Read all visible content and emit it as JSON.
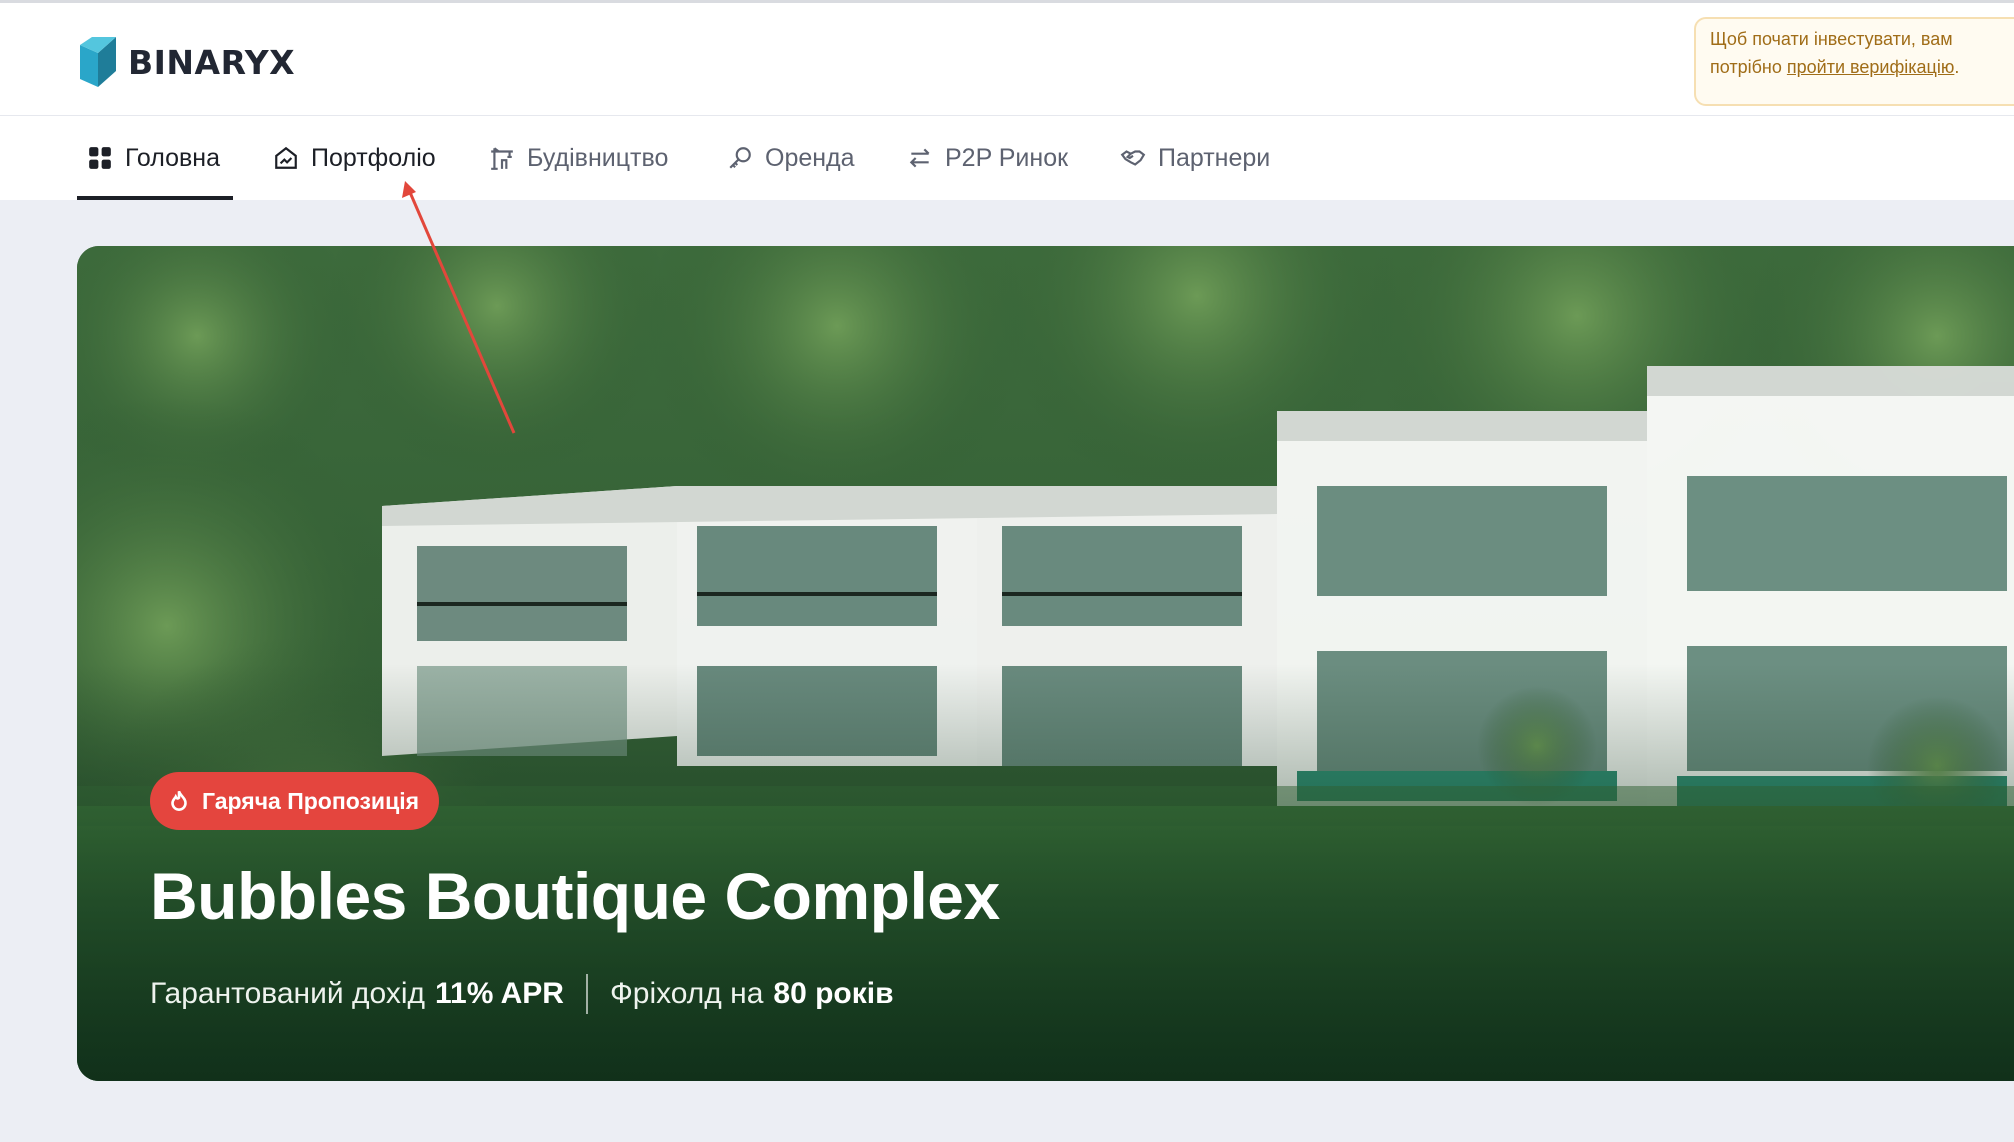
{
  "brand": {
    "name": "BINARYX",
    "logo_icon": "binaryx-logo-icon"
  },
  "notice": {
    "text_before": "Щоб почати інвестувати, вам потрібно ",
    "link_text": "пройти верифікацію",
    "text_after": "."
  },
  "nav": {
    "items": [
      {
        "label": "Головна",
        "icon": "grid-icon",
        "active": true
      },
      {
        "label": "Портфоліо",
        "icon": "house-chart-icon",
        "active": false
      },
      {
        "label": "Будівництво",
        "icon": "crane-icon",
        "active": false
      },
      {
        "label": "Оренда",
        "icon": "key-icon",
        "active": false
      },
      {
        "label": "P2P Ринок",
        "icon": "swap-arrows-icon",
        "active": false
      },
      {
        "label": "Партнери",
        "icon": "handshake-icon",
        "active": false
      }
    ]
  },
  "hero": {
    "badge": "Гаряча Пропозиція",
    "badge_icon": "flame-icon",
    "title": "Bubbles Boutique Complex",
    "income_label": "Гарантований дохід",
    "income_value": "11% APR",
    "freehold_label": "Фріхолд на",
    "freehold_value": "80 років"
  },
  "colors": {
    "badge": "#e4453e",
    "notice_border": "#f6dfb2",
    "notice_text": "#a06d18",
    "annotation_arrow": "#e2473b"
  }
}
